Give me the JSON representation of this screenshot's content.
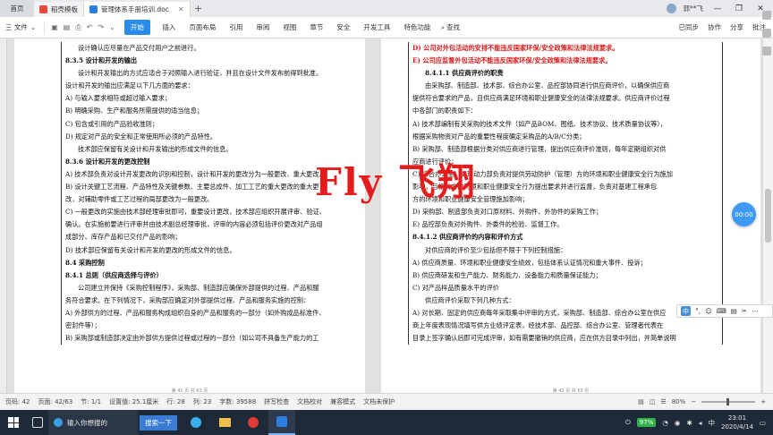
{
  "tabs": {
    "home": "首页",
    "tab1": "稻壳模板",
    "tab2": "管理体系手册培训.doc"
  },
  "titlebar": {
    "right_label": "郭**飞",
    "win_btns": [
      "—",
      "❐",
      "✕"
    ]
  },
  "ribbon": {
    "file": "三 文件",
    "start": "开始",
    "menu": [
      "插入",
      "页面布局",
      "引用",
      "审阅",
      "视图",
      "章节",
      "安全",
      "开发工具",
      "特色功能"
    ],
    "search": "查找",
    "right": [
      "已同步",
      "协作",
      "分享",
      "批注"
    ]
  },
  "page1": {
    "lines": [
      {
        "t": "设计确认应尽量在产品交付用户之前进行。",
        "c": "ind"
      },
      {
        "t": "8.3.5 设计和开发的输出",
        "c": "b"
      },
      {
        "t": "设计和开发输出的方式应适合于对照输入进行验证，并且在设计文件发布前得到批准。",
        "c": "ind"
      },
      {
        "t": "设计和开发的输出应满足以下几方面的要求：",
        "c": ""
      },
      {
        "t": "A)  与输入要求相符或超过输入要求；",
        "c": ""
      },
      {
        "t": "B)  明确采购、生产和服务所需提供的适当信息；",
        "c": ""
      },
      {
        "t": "C)  包含或引用的产品验收准则；",
        "c": ""
      },
      {
        "t": "D)  规定对产品的安全和正常使用所必须的产品特性。",
        "c": ""
      },
      {
        "t": "技术部应保留有关设计和开发输出的形成文件的信息。",
        "c": "ind"
      },
      {
        "t": "8.3.6 设计和开发的更改控制",
        "c": "b"
      },
      {
        "t": "A)  技术部负责对设计开发更改的识别和控制，设计和开发的更改分为一般更改、重大更改。",
        "c": ""
      },
      {
        "t": "B)  设计关键工艺流程、产品特性及关键参数、主要总成件、加工工艺的重大更改的重大更",
        "c": ""
      },
      {
        "t": "改，对辅助零件或工艺过程的局部更改为一般更改。",
        "c": ""
      },
      {
        "t": "C)  一般更改的实施由技术部经理审批即可，重要设计更改，技术部应组织开展评审、验证、",
        "c": ""
      },
      {
        "t": "确认。在实施前要进行评审并由技术副总经理审批，评审的内容必须包括评价更改对产品组",
        "c": ""
      },
      {
        "t": "成部分、库存产品和已交付产品的影响；",
        "c": ""
      },
      {
        "t": "D)  技术部应保留有关设计和开发的更改的形成文件的信息。",
        "c": ""
      },
      {
        "t": "8.4 采购控制",
        "c": "b"
      },
      {
        "t": "8.4.1 总则（供应商选择与评价）",
        "c": "b"
      },
      {
        "t": "公司建立并保持《采购控制程序》，采购部、制造部应确保外部提供的过程、产品和服",
        "c": "ind"
      },
      {
        "t": "务符合要求。在下列情况下，采购部应确定对外部提供过程、产品和服务实施的控制：",
        "c": ""
      },
      {
        "t": "A)  外部供方的过程、产品和服务构成组织自身的产品和服务的一部分（如外购成品标准件、",
        "c": ""
      },
      {
        "t": "密封件等）；",
        "c": ""
      },
      {
        "t": "B)  采购部或制造部决定由外部供方提供过程或过程的一部分（如公司不具备生产能力的工",
        "c": ""
      }
    ],
    "footer": "第 41 页 共 63 页"
  },
  "page2": {
    "lines": [
      {
        "t": "D) 公司对外包活动的安排不能违反国家环保/安全政策和法律法规要求。",
        "c": "red"
      },
      {
        "t": "E) 公司应监督外包活动不能违反国家环保/安全政策和法律法规要求。",
        "c": "red"
      },
      {
        "t": "8.4.1.1 供应商评价的职责",
        "c": "b ind"
      },
      {
        "t": "由采购部、制造部、技术部、综合办公室、品控部协同进行供应商评价，以确保供应商",
        "c": "ind"
      },
      {
        "t": "提供符合要求的产品，且供应商满足环境和职业健康安全的法律法规要求。供应商评价过程",
        "c": ""
      },
      {
        "t": "中各部门的职责如下：",
        "c": ""
      },
      {
        "t": "A)  技术部编制有关采购的技术文件（如产品BOM、图纸、技术协议、技术质量协议等），",
        "c": ""
      },
      {
        "t": "根据采购物资对产品的重要性程度确定采购品的A/B/C分类；",
        "c": ""
      },
      {
        "t": "B)  采购部、制造部根据分类对供应商进行管理，提出供应商评价准则，每年定期组织对供",
        "c": ""
      },
      {
        "t": "应商进行评价；",
        "c": ""
      },
      {
        "t": "C)  综合办公室、安环动力部负责对提供劳动防护（管理）方的环境和职业健康安全行为施加",
        "c": ""
      },
      {
        "t": "影响，与相关方的环境和职业健康安全行为提出要求并进行监督，负责对基建工程承包",
        "c": ""
      },
      {
        "t": "方的环境和职业健康安全管理施加影响；",
        "c": ""
      },
      {
        "t": "D)  采购部、制造部负责对口原材料、外购件、外协件的采购工作；",
        "c": ""
      },
      {
        "t": "E)  品控部负责对外购件、外委件的检验、监督工作。",
        "c": ""
      },
      {
        "t": "8.4.1.2 供应商评价的内容和评价方式",
        "c": "b"
      },
      {
        "t": "对供应商的评价至少包括但不限于下列控制措施：",
        "c": "ind"
      },
      {
        "t": "A)  供应商质量、环境和职业健康安全绩效，包括体系认证情况和重大事件、投诉；",
        "c": ""
      },
      {
        "t": "B)  供应商研发和生产能力、财务能力、设备能力和质量保证能力；",
        "c": ""
      },
      {
        "t": "C)  对产品样品质量水平的评价",
        "c": ""
      },
      {
        "t": "供应商评价采取下列几种方式：",
        "c": "ind"
      },
      {
        "t": "A)  对长期、固定的供应商每年采取集中评审的方式，采购部、制造部、综合办公室在供应",
        "c": ""
      },
      {
        "t": "商上年度表现情况填写供方业绩评定表，经技术部、品控部、综合办公室、管理者代表在",
        "c": ""
      },
      {
        "t": "目录上签字确认后即可完成评审，如有需要撤销的供应商，应在供方目录中列出，并简单说明",
        "c": ""
      }
    ],
    "footer": "第 42 页 共 63 页"
  },
  "watermark": "Fly 飞翔",
  "float_btn": "00:00",
  "ime": {
    "label": "中",
    "items": [
      "°,",
      "☺",
      "⌨",
      "▤",
      "✂",
      "⋯"
    ]
  },
  "statusbar": {
    "items": [
      "页码: 42",
      "页面: 42/63",
      "节: 1/1",
      "设置值: 25.1厘米",
      "行: 28",
      "列: 23",
      "字数: 39588",
      "拼写检查",
      "文档校对",
      "兼容模式",
      "文档未保护"
    ],
    "zoom": "80%"
  },
  "taskbar": {
    "search_text": "输入你想搜的",
    "search_btn": "搜索一下",
    "battery": "97%",
    "ime": "中",
    "time": "23:01",
    "date": "2020/4/14"
  },
  "colors": {
    "accent": "#2b8ce8",
    "red_text": "#d81b1b",
    "taskbar": "#1f2a38"
  }
}
